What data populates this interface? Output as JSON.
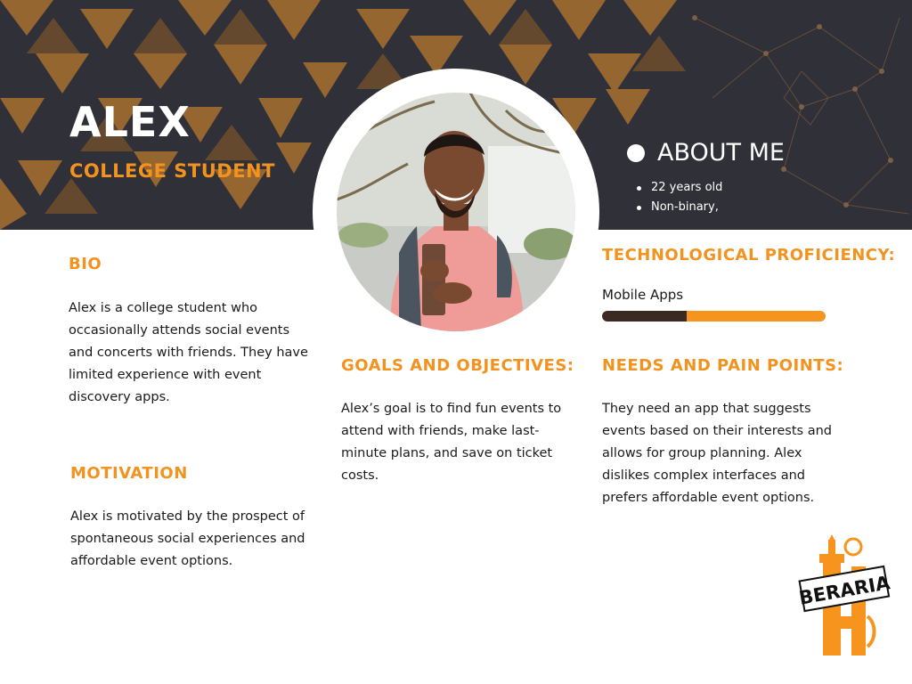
{
  "persona": {
    "name": "ALEX",
    "role": "COLLEGE STUDENT"
  },
  "about": {
    "title": "ABOUT ME",
    "items": [
      "22 years old",
      "Non-binary,"
    ]
  },
  "bio": {
    "title": "BIO",
    "text": "Alex is a college student who occasionally attends social events and concerts with friends. They have limited experience with event discovery apps."
  },
  "motivation": {
    "title": "MOTIVATION",
    "text": "Alex is motivated by the prospect of spontaneous social experiences and affordable event options."
  },
  "goals": {
    "title": "GOALS AND OBJECTIVES:",
    "text": "Alex’s goal is to find fun events to attend with friends, make last-minute plans, and save on ticket costs."
  },
  "tech": {
    "title": "TECHNOLOGICAL PROFICIENCY:",
    "skill_label": "Mobile Apps",
    "skill_level": 0.38
  },
  "needs": {
    "title": "NEEDS AND PAIN POINTS:",
    "text": "They need an app that suggests events based on their interests and allows for group planning. Alex dislikes complex interfaces and prefers affordable event options."
  },
  "logo": {
    "text": "BERARIA",
    "letter": "H"
  },
  "colors": {
    "accent": "#f2921f",
    "header_bg": "#2f3038",
    "bar_fill": "#3a2a22",
    "text": "#1a1a1a"
  }
}
